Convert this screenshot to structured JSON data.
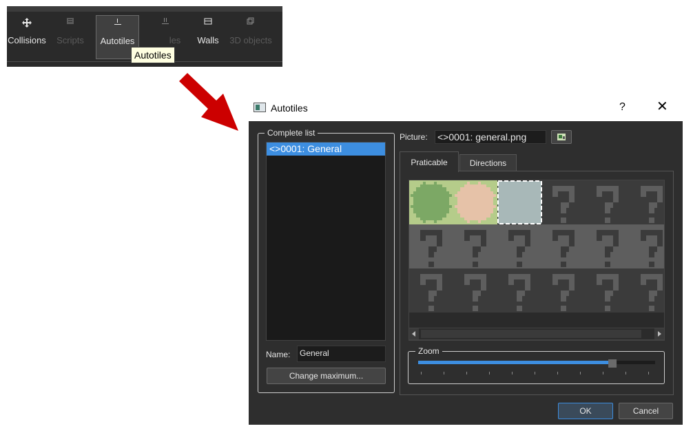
{
  "toolbar": {
    "items": [
      {
        "label": "Collisions",
        "icon": "move-arrows-icon",
        "state": "normal"
      },
      {
        "label": "Scripts",
        "icon": "script-icon",
        "state": "disabled"
      },
      {
        "label": "Autotiles",
        "icon": "autotile-icon",
        "state": "active"
      },
      {
        "label": "les",
        "icon": "mountain-icon",
        "state": "disabled"
      },
      {
        "label": "Walls",
        "icon": "wall-icon",
        "state": "normal"
      },
      {
        "label": "3D objects",
        "icon": "cube-icon",
        "state": "disabled"
      }
    ],
    "tooltip": "Autotiles"
  },
  "dialog": {
    "title": "Autotiles",
    "help": "?",
    "close": "✕",
    "complete_list": {
      "title": "Complete list",
      "items": [
        "<>0001: General"
      ]
    },
    "name_label": "Name:",
    "name_value": "General",
    "change_max": "Change maximum...",
    "picture_label": "Picture:",
    "picture_value": "<>0001: general.png",
    "tabs": [
      "Praticable",
      "Directions"
    ],
    "zoom": {
      "title": "Zoom",
      "value": 0.82
    },
    "ok": "OK",
    "cancel": "Cancel"
  },
  "colors": {
    "accent": "#3d8ee0",
    "arrow": "#cc0000",
    "tile_green": "#7ca865",
    "tile_peach": "#e6c2a8",
    "tile_blue": "#a8b8b8",
    "tile_bg_light": "#b5cc8a"
  }
}
